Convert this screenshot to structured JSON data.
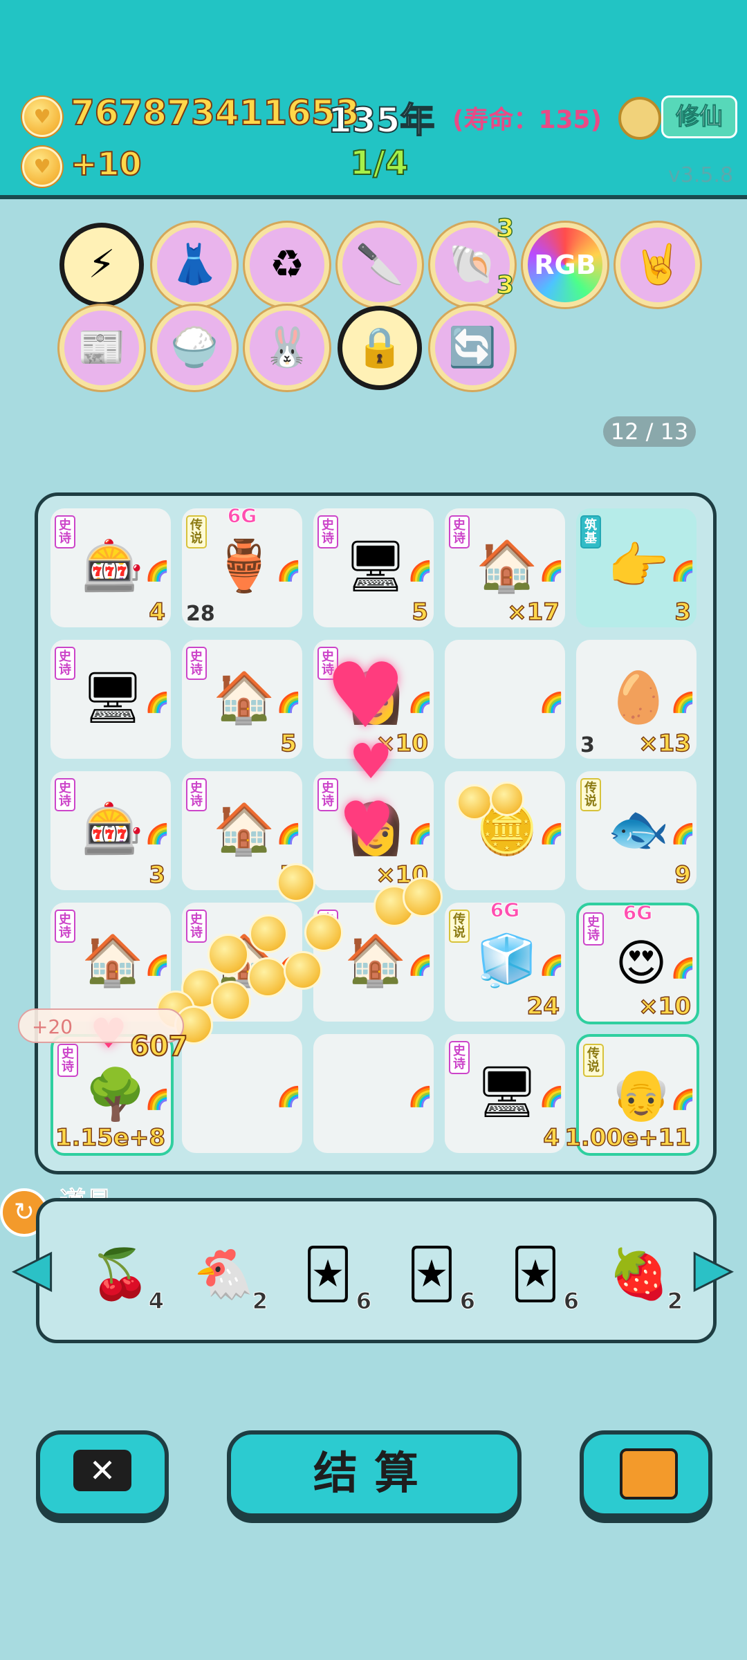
{
  "header": {
    "coins": "767873411653",
    "years": "135年",
    "lifespan": "(寿命：135)",
    "income": "+10",
    "progress": "1/4",
    "cultivate_button": "修仙",
    "version": "v3.5.8"
  },
  "skills": [
    {
      "icon": "lightning-icon",
      "glyph": "⚡",
      "active": true
    },
    {
      "icon": "skirt-icon",
      "glyph": "👗"
    },
    {
      "icon": "recycle-icon",
      "glyph": "♻"
    },
    {
      "icon": "cleaver-icon",
      "glyph": "🔪"
    },
    {
      "icon": "shell-icon",
      "glyph": "🐚",
      "badge_top": "3",
      "badge_bottom": "3"
    },
    {
      "icon": "rgb-icon",
      "glyph": "RGB"
    },
    {
      "icon": "rock-hand-icon",
      "glyph": "🤘"
    },
    {
      "icon": "time-magazine-icon",
      "glyph": "📰"
    },
    {
      "icon": "rice-bowl-upgrade-icon",
      "glyph": "🍚"
    },
    {
      "icon": "rabbit-icon",
      "glyph": "🐰"
    },
    {
      "icon": "safe-icon",
      "glyph": "🔒",
      "active": true
    },
    {
      "icon": "refresh-icon",
      "glyph": "🔄"
    }
  ],
  "page_indicator": "12 / 13",
  "board": [
    {
      "tag": "史诗",
      "tag_type": "epic",
      "icon": "capsule-machine-icon",
      "glyph": "🎰",
      "count": "4"
    },
    {
      "tag": "传说",
      "tag_type": "legend",
      "icon": "green-vase-icon",
      "glyph": "🏺",
      "level": "6G",
      "left_count": "28"
    },
    {
      "tag": "史诗",
      "tag_type": "epic",
      "icon": "pc-fan-case-icon",
      "glyph": "🖥",
      "count": "5"
    },
    {
      "tag": "史诗",
      "tag_type": "epic",
      "icon": "rabbit-house-icon",
      "glyph": "🏠",
      "count": "×17"
    },
    {
      "tag": "筑基",
      "tag_type": "zhuji",
      "icon": "pointing-hand-icon",
      "glyph": "👉",
      "count": "3",
      "highlight": true
    },
    {
      "tag": "史诗",
      "tag_type": "epic",
      "icon": "pc-fan-case-icon",
      "glyph": "🖥",
      "count": ""
    },
    {
      "tag": "史诗",
      "tag_type": "epic",
      "icon": "rabbit-house-icon",
      "glyph": "🏠",
      "count": "5"
    },
    {
      "tag": "史诗",
      "tag_type": "epic",
      "icon": "girl-portrait-icon",
      "glyph": "👩",
      "count": "×10"
    },
    {
      "tag": "",
      "icon": "",
      "glyph": "",
      "count": ""
    },
    {
      "tag": "",
      "icon": "egg-icon",
      "glyph": "🥚",
      "count": "×13",
      "left_count": "3"
    },
    {
      "tag": "史诗",
      "tag_type": "epic",
      "icon": "capsule-machine-icon",
      "glyph": "🎰",
      "count": "3"
    },
    {
      "tag": "史诗",
      "tag_type": "epic",
      "icon": "rabbit-house-icon",
      "glyph": "🏠",
      "count": "7"
    },
    {
      "tag": "史诗",
      "tag_type": "epic",
      "icon": "girl-portrait-icon",
      "glyph": "👩",
      "count": "×10"
    },
    {
      "tag": "",
      "icon": "coin-pile-icon",
      "glyph": "🪙",
      "count": ""
    },
    {
      "tag": "传说",
      "tag_type": "legend",
      "icon": "koi-fish-icon",
      "glyph": "🐟",
      "count": "9"
    },
    {
      "tag": "史诗",
      "tag_type": "epic",
      "icon": "rabbit-house-icon",
      "glyph": "🏠",
      "count": ""
    },
    {
      "tag": "史诗",
      "tag_type": "epic",
      "icon": "rabbit-house-icon",
      "glyph": "🏠",
      "count": ""
    },
    {
      "tag": "史诗",
      "tag_type": "epic",
      "icon": "rabbit-house-icon",
      "glyph": "🏠",
      "count": ""
    },
    {
      "tag": "传说",
      "tag_type": "legend",
      "icon": "fridge-icon",
      "glyph": "🧊",
      "count": "24",
      "level": "6G"
    },
    {
      "tag": "史诗",
      "tag_type": "epic",
      "icon": "heart-eyes-face-icon",
      "glyph": "😍",
      "count": "×10",
      "level": "6G",
      "glow": true
    },
    {
      "tag": "史诗",
      "tag_type": "epic",
      "icon": "money-tree-icon",
      "glyph": "🌳",
      "count": "1.15e+8",
      "glow": true
    },
    {
      "tag": "",
      "icon": "",
      "glyph": "",
      "count": ""
    },
    {
      "tag": "",
      "icon": "",
      "glyph": "",
      "count": ""
    },
    {
      "tag": "史诗",
      "tag_type": "epic",
      "icon": "pc-fan-case-icon",
      "glyph": "🖥",
      "count": "4"
    },
    {
      "tag": "传说",
      "tag_type": "legend",
      "icon": "old-man-face-icon",
      "glyph": "👴",
      "count": "1.00e+11",
      "glow": true
    }
  ],
  "floating": {
    "toast": "+20 ",
    "damage": "607"
  },
  "props": {
    "title": "道具",
    "items": [
      {
        "icon": "lychee-icon",
        "glyph": "🍒",
        "count": "4"
      },
      {
        "icon": "chicken-icon",
        "glyph": "🐔",
        "count": "2"
      },
      {
        "icon": "blue-cards-icon",
        "glyph": "🃏",
        "count": "6"
      },
      {
        "icon": "epic-cards-icon",
        "glyph": "🃏",
        "count": "6"
      },
      {
        "icon": "legend-cards-icon",
        "glyph": "🃏",
        "count": "6"
      },
      {
        "icon": "strawberry-icon",
        "glyph": "🍓",
        "count": "2"
      }
    ]
  },
  "footer": {
    "settle_label": "结算"
  }
}
